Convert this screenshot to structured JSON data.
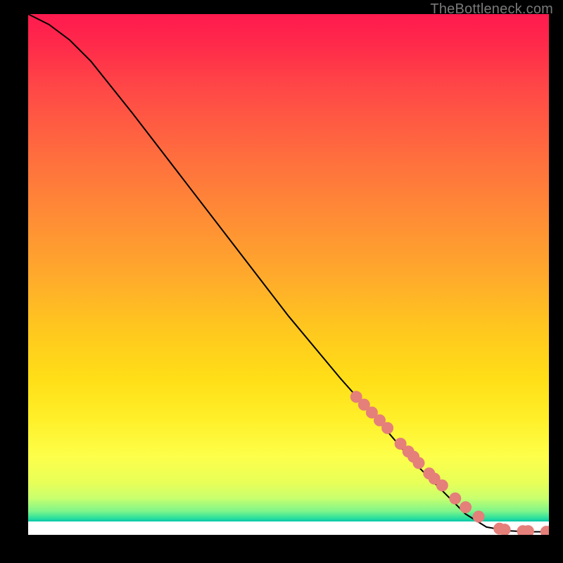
{
  "attribution": "TheBottleneck.com",
  "colors": {
    "marker": "#e57f7a",
    "curve": "#000000"
  },
  "chart_data": {
    "type": "line",
    "title": "",
    "xlabel": "",
    "ylabel": "",
    "xlim": [
      0,
      100
    ],
    "ylim": [
      0,
      100
    ],
    "grid": false,
    "legend": false,
    "series": [
      {
        "name": "bottleneck-curve",
        "x": [
          0,
          4,
          8,
          12,
          20,
          30,
          40,
          50,
          60,
          68,
          74,
          80,
          84,
          88,
          92,
          96,
          100
        ],
        "y": [
          100,
          98,
          95,
          91,
          81,
          68,
          55,
          42,
          30,
          21,
          14,
          8,
          4,
          1.5,
          0.8,
          0.6,
          0.6
        ]
      }
    ],
    "markers": {
      "name": "highlighted-points",
      "x": [
        63,
        64.5,
        66,
        67.5,
        69,
        71.5,
        73,
        74,
        75,
        77,
        78,
        79.5,
        82,
        84,
        86.5,
        90.5,
        91.5,
        95,
        96,
        99.5,
        100
      ],
      "y": [
        26.5,
        25,
        23.5,
        22,
        20.5,
        17.5,
        16,
        15,
        13.8,
        11.8,
        10.8,
        9.5,
        7,
        5.3,
        3.5,
        1.2,
        1.0,
        0.7,
        0.7,
        0.6,
        0.6
      ]
    }
  }
}
